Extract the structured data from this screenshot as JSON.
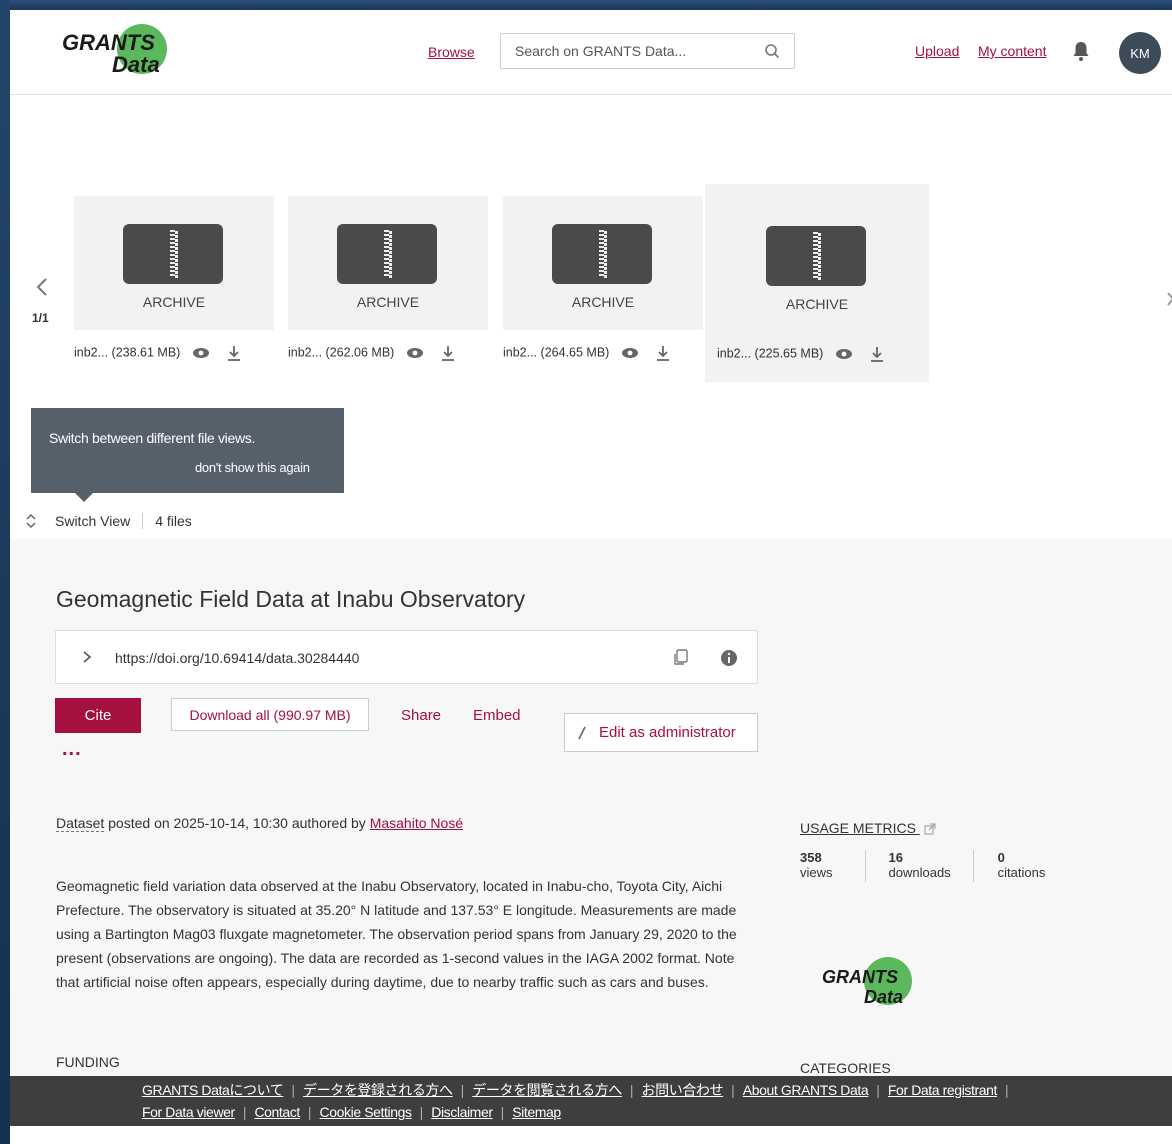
{
  "header": {
    "logo_line1": "GRANTS",
    "logo_line2": "Data",
    "browse": "Browse",
    "search_placeholder": "Search on GRANTS Data...",
    "upload": "Upload",
    "my_content": "My content",
    "avatar_initials": "KM"
  },
  "carousel": {
    "pager": "1/1",
    "files": [
      {
        "type_label": "ARCHIVE",
        "name": "inb2...",
        "size": "(238.61 MB)"
      },
      {
        "type_label": "ARCHIVE",
        "name": "inb2...",
        "size": "(262.06 MB)"
      },
      {
        "type_label": "ARCHIVE",
        "name": "inb2...",
        "size": "(264.65 MB)"
      },
      {
        "type_label": "ARCHIVE",
        "name": "inb2...",
        "size": "(225.65 MB)"
      }
    ]
  },
  "tooltip": {
    "text": "Switch between different file views.",
    "dismiss": "don't show this again"
  },
  "switch_view": {
    "label": "Switch View",
    "count": "4 files"
  },
  "item": {
    "title": "Geomagnetic Field Data at Inabu Observatory",
    "doi_url": "https://doi.org/10.69414/data.30284440",
    "cite": "Cite",
    "download_all": "Download all (990.97 MB)",
    "share": "Share",
    "embed": "Embed",
    "more": "...",
    "edit_admin": "Edit as administrator",
    "posted_type": "Dataset",
    "posted_text": " posted on 2025-10-14, 10:30 authored by ",
    "author": "Masahito Nosé",
    "description": "Geomagnetic field variation data observed at the Inabu Observatory, located in Inabu-cho, Toyota City, Aichi Prefecture. The observatory is situated at 35.20° N latitude and 137.53° E longitude. Measurements are made using a Bartington Mag03 fluxgate magnetometer. The observation period spans from January 29, 2020 to the present (observations are ongoing). The data are recorded as 1-second values in the IAGA 2002 format. Note that artificial noise often appears, especially during daytime, due to nearby traffic such as cars and buses.",
    "funding": "FUNDING"
  },
  "metrics": {
    "heading": "USAGE METRICS",
    "views_num": "358",
    "views_label": "views",
    "downloads_num": "16",
    "downloads_label": "downloads",
    "citations_num": "0",
    "citations_label": "citations"
  },
  "categories": "CATEGORIES",
  "footer": {
    "links_row1": [
      "GRANTS Dataについて",
      "データを登録される方へ",
      "データを閲覧される方へ",
      "お問い合わせ",
      "About GRANTS Data",
      "For Data registrant"
    ],
    "links_row2": [
      "For Data viewer",
      "Contact",
      "Cookie Settings",
      "Disclaimer",
      "Sitemap"
    ]
  },
  "colors": {
    "accent": "#a5103f",
    "logo_green": "#5cb85c",
    "footer_bg": "#3e3e3e"
  }
}
